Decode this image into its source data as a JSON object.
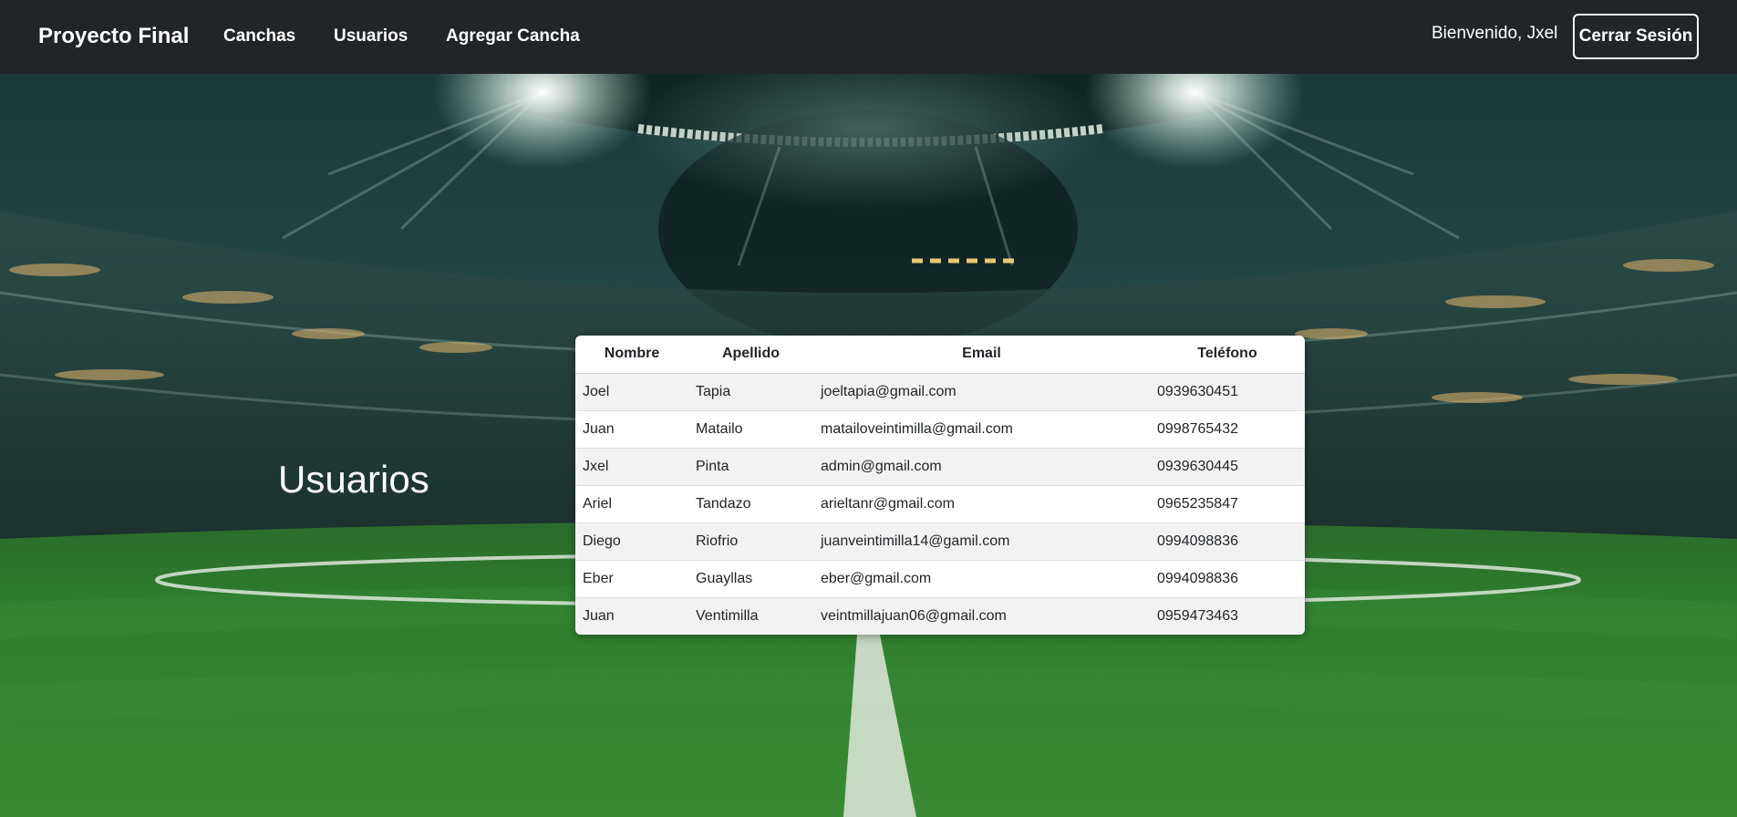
{
  "navbar": {
    "brand": "Proyecto Final",
    "links": {
      "canchas": "Canchas",
      "usuarios": "Usuarios",
      "agregar_cancha": "Agregar Cancha"
    },
    "welcome": "Bienvenido, Jxel",
    "logout_label": "Cerrar Sesión"
  },
  "page": {
    "title": "Usuarios"
  },
  "users_table": {
    "headers": [
      "Nombre",
      "Apellido",
      "Email",
      "Teléfono"
    ],
    "rows": [
      [
        "Joel",
        "Tapia",
        "joeltapia@gmail.com",
        "0939630451"
      ],
      [
        "Juan",
        "Matailo",
        "matailoveintimilla@gmail.com",
        "0998765432"
      ],
      [
        "Jxel",
        "Pinta",
        "admin@gmail.com",
        "0939630445"
      ],
      [
        "Ariel",
        "Tandazo",
        "arieltanr@gmail.com",
        "0965235847"
      ],
      [
        "Diego",
        "Riofrio",
        "juanveintimilla14@gamil.com",
        "0994098836"
      ],
      [
        "Eber",
        "Guayllas",
        "eber@gmail.com",
        "0994098836"
      ],
      [
        "Juan",
        "Ventimilla",
        "veintmillajuan06@gmail.com",
        "0959473463"
      ]
    ]
  },
  "colors": {
    "navbar_bg": "#212529",
    "text_white": "#ffffff",
    "row_alt": "#f2f2f2"
  }
}
